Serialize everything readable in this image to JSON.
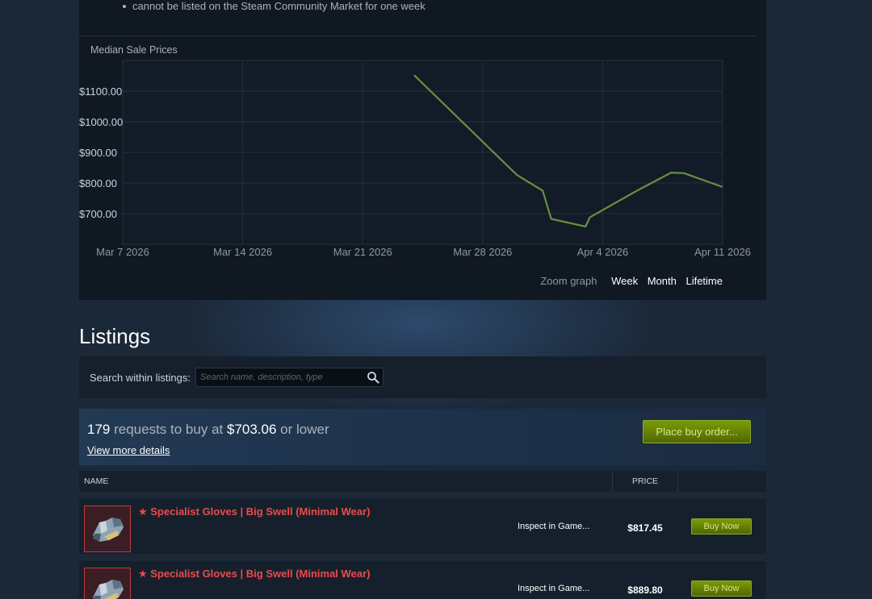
{
  "notice": {
    "bullet": "cannot be listed on the Steam Community Market for one week"
  },
  "graph": {
    "title": "Median Sale Prices",
    "zoom_label": "Zoom graph",
    "zoom_options": [
      "Week",
      "Month",
      "Lifetime"
    ]
  },
  "chart_data": {
    "type": "line",
    "title": "Median Sale Prices",
    "xlabel": "",
    "ylabel": "",
    "x_tick_labels": [
      "Mar 7 2026",
      "Mar 14 2026",
      "Mar 21 2026",
      "Mar 28 2026",
      "Apr 4 2026",
      "Apr 11 2026"
    ],
    "y_tick_labels": [
      "$1100.00",
      "$1000.00",
      "$900.00",
      "$800.00",
      "$700.00"
    ],
    "y_ticks": [
      1100,
      1000,
      900,
      800,
      700
    ],
    "xlim": [
      "2026-03-07",
      "2026-04-11"
    ],
    "ylim": [
      600,
      1200
    ],
    "grid": true,
    "series": [
      {
        "x": [
          "2026-03-24",
          "2026-03-30",
          "2026-03-31T12:00",
          "2026-04-01",
          "2026-04-03",
          "2026-04-03T06:00",
          "2026-04-06",
          "2026-04-08",
          "2026-04-08T18:00",
          "2026-04-11"
        ],
        "y": [
          1152,
          826,
          775,
          683,
          658,
          688,
          775,
          834,
          832,
          787
        ],
        "color": "#688f3e"
      }
    ]
  },
  "listings": {
    "title": "Listings",
    "search_label": "Search within listings:",
    "search_placeholder": "Search name, description, type",
    "buy_orders": {
      "count": "179",
      "middle_text": "requests to buy at",
      "price": "$703.06",
      "suffix": "or lower",
      "view_details": "View more details",
      "button": "Place buy order..."
    },
    "columns": {
      "name": "NAME",
      "price": "PRICE"
    },
    "rows": [
      {
        "name": "★ Specialist Gloves | Big Swell (Minimal Wear)",
        "inspect": "Inspect in Game...",
        "price": "$817.45",
        "button": "Buy Now"
      },
      {
        "name": "★ Specialist Gloves | Big Swell (Minimal Wear)",
        "inspect": "Inspect in Game...",
        "price": "$889.80",
        "button": "Buy Now"
      }
    ]
  }
}
